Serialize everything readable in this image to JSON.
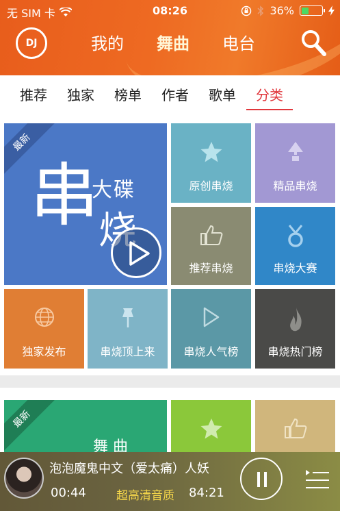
{
  "status": {
    "carrier": "无 SIM 卡",
    "time": "08:26",
    "battery": "36%",
    "battery_level": 0.36
  },
  "header": {
    "logo_text": "DJ",
    "tabs": [
      "我的",
      "舞曲",
      "电台"
    ],
    "active_tab": "舞曲"
  },
  "subtabs": [
    "推荐",
    "独家",
    "榜单",
    "作者",
    "歌单",
    "分类"
  ],
  "active_subtab": "分类",
  "featured": {
    "ribbon": "最新",
    "big_char": "串",
    "small_text": "大碟",
    "big_char2": "烧"
  },
  "tiles": {
    "original": "原创串烧",
    "premium": "精品串烧",
    "recommended": "推荐串烧",
    "contest": "串烧大赛",
    "exclusive": "独家发布",
    "top": "串烧顶上来",
    "popular": "串烧人气榜",
    "hot": "串烧热门榜"
  },
  "second": {
    "ribbon": "最新",
    "text": "舞 曲"
  },
  "player": {
    "song": "泡泡魔鬼中文（爱太痛）人妖",
    "current": "00:44",
    "quality": "超高清音质",
    "total": "84:21"
  },
  "colors": {
    "header": "#ea6020",
    "accent": "#e1373c",
    "quality": "#f5d64a"
  }
}
